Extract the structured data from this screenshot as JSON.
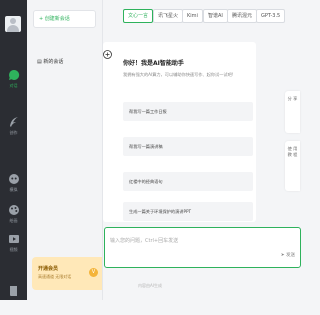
{
  "colors": {
    "accent": "#2eb25c",
    "rail_bg": "#2b2d33",
    "vip_bg": "#ffe8b8"
  },
  "rail": {
    "items": [
      {
        "label": "对话",
        "icon": "chat-icon",
        "active": true
      },
      {
        "label": "创作",
        "icon": "feather-icon"
      },
      {
        "label": "模拟",
        "icon": "bot-icon"
      },
      {
        "label": "绘画",
        "icon": "palette-icon"
      },
      {
        "label": "视频",
        "icon": "video-icon"
      },
      {
        "label": "",
        "icon": "book-icon"
      }
    ]
  },
  "sessions": {
    "new_chat_label": "+ 创建新会话",
    "items": [
      {
        "label": "新的会话"
      }
    ]
  },
  "vip": {
    "title": "开通会员",
    "subtitle": "高速通道 无限对话",
    "badge": "V"
  },
  "tabs": [
    {
      "label": "文心一言",
      "active": true
    },
    {
      "label": "讯飞星火"
    },
    {
      "label": "Kimi"
    },
    {
      "label": "智谱AI"
    },
    {
      "label": "腾讯混元"
    },
    {
      "label": "GPT-3.5"
    }
  ],
  "welcome": {
    "title": "你好！我是AI智能助手",
    "subtitle": "我拥有强大的AI算力，可以辅助你快速写作、起你试一试吧!",
    "suggestions": [
      "帮我写一篇工作日报",
      "帮我写一篇演讲稿",
      "红楼中的经典语句",
      "生成一篇关于环境保护的演讲PPT"
    ]
  },
  "input": {
    "placeholder": "输入您的问题，Ctrl+回车发送",
    "send_label": "发送"
  },
  "footer": "内容由AI生成",
  "float_cards": [
    {
      "label": "分 享"
    },
    {
      "label": "使 用 教 程"
    }
  ]
}
